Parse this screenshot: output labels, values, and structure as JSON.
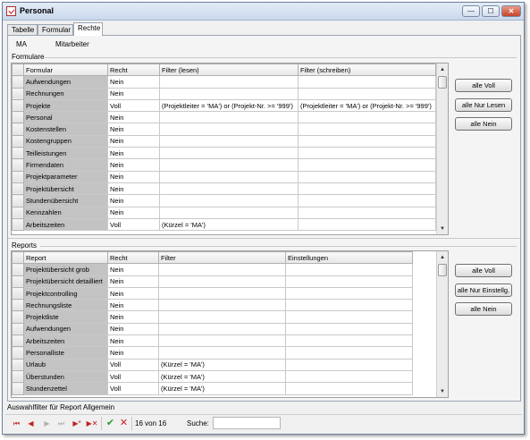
{
  "window": {
    "title": "Personal",
    "buttons": {
      "minimize": "—",
      "maximize": "☐",
      "close": "✕"
    }
  },
  "tabs": [
    {
      "label": "Tabelle",
      "active": false
    },
    {
      "label": "Formular",
      "active": false
    },
    {
      "label": "Rechte",
      "active": true
    }
  ],
  "employee": {
    "key": "MA",
    "value": "Mitarbeiter"
  },
  "formulare": {
    "section_label": "Formulare",
    "headers": [
      "Formular",
      "Recht",
      "Filter (lesen)",
      "Filter (schreiben)"
    ],
    "rows": [
      [
        "Aufwendungen",
        "Nein",
        "",
        ""
      ],
      [
        "Rechnungen",
        "Nein",
        "",
        ""
      ],
      [
        "Projekte",
        "Voll",
        "(Projektleiter = 'MA') or (Projekt-Nr. >= '999')",
        "(Projektleiter = 'MA') or (Projekt-Nr. >= '999')"
      ],
      [
        "Personal",
        "Nein",
        "",
        ""
      ],
      [
        "Kostenstellen",
        "Nein",
        "",
        ""
      ],
      [
        "Kostengruppen",
        "Nein",
        "",
        ""
      ],
      [
        "Teilleistungen",
        "Nein",
        "",
        ""
      ],
      [
        "Firmendaten",
        "Nein",
        "",
        ""
      ],
      [
        "Projektparameter",
        "Nein",
        "",
        ""
      ],
      [
        "Projektübersicht",
        "Nein",
        "",
        ""
      ],
      [
        "Stundenübersicht",
        "Nein",
        "",
        ""
      ],
      [
        "Kennzahlen",
        "Nein",
        "",
        ""
      ],
      [
        "Arbeitszeiten",
        "Voll",
        "(Kürzel = 'MA')",
        ""
      ]
    ],
    "buttons": [
      "alle Voll",
      "alle Nur Lesen",
      "alle Nein"
    ]
  },
  "reports": {
    "section_label": "Reports",
    "headers": [
      "Report",
      "Recht",
      "Filter",
      "Einstellungen"
    ],
    "rows": [
      [
        "Projektübersicht grob",
        "Nein",
        "",
        ""
      ],
      [
        "Projektübersicht detailliert",
        "Nein",
        "",
        ""
      ],
      [
        "Projektcontrolling",
        "Nein",
        "",
        ""
      ],
      [
        "Rechnungsliste",
        "Nein",
        "",
        ""
      ],
      [
        "Projektliste",
        "Nein",
        "",
        ""
      ],
      [
        "Aufwendungen",
        "Nein",
        "",
        ""
      ],
      [
        "Arbeitszeiten",
        "Nein",
        "",
        ""
      ],
      [
        "Personalliste",
        "Nein",
        "",
        ""
      ],
      [
        "Urlaub",
        "Voll",
        "(Kürzel = 'MA')",
        ""
      ],
      [
        "Überstunden",
        "Voll",
        "(Kürzel = 'MA')",
        ""
      ],
      [
        "Stundenzettel",
        "Voll",
        "(Kürzel = 'MA')",
        ""
      ]
    ],
    "buttons": [
      "alle Voll",
      "alle Nur Einstellg.",
      "alle Nein"
    ]
  },
  "status_text": "Auswahlfilter für Report Allgemein",
  "navigation": {
    "record_info": "16 von 16",
    "search_label": "Suche:",
    "search_value": "",
    "icons": {
      "first": "⏮",
      "prev": "◀",
      "next": "▶",
      "last": "⏭",
      "new": "▶*",
      "delete": "▶✕",
      "confirm": "✔",
      "cancel": "✕"
    }
  },
  "colors": {
    "name_column_bg": "#c3c3c3",
    "nav_icon": "#c02020",
    "confirm_icon": "#2a9a2a"
  }
}
